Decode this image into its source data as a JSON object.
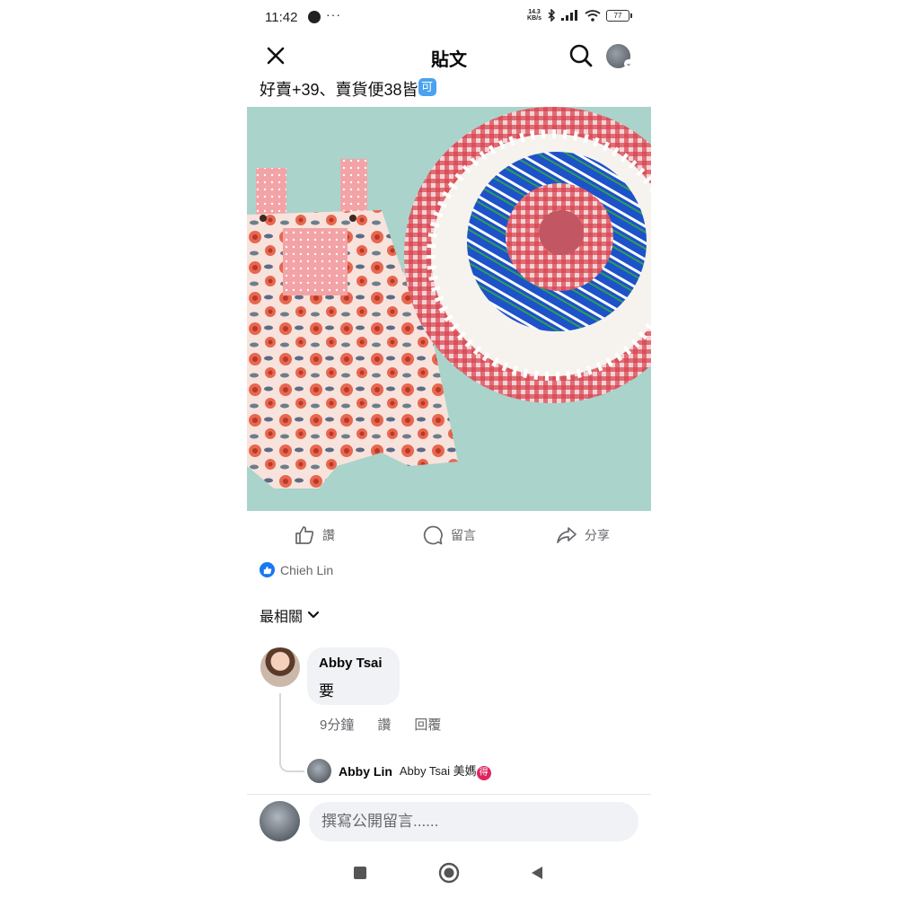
{
  "status_bar": {
    "time": "11:42",
    "more": "···",
    "speed_value": "14.3",
    "speed_unit": "KB/s",
    "battery": "77"
  },
  "header": {
    "title": "貼文"
  },
  "post": {
    "text": "好賣+39、賣貨便38皆",
    "badge": "可"
  },
  "actions": {
    "like": "讚",
    "comment": "留言",
    "share": "分享"
  },
  "reactions": {
    "liker": "Chieh Lin"
  },
  "comments_sort": "最相關",
  "comment": {
    "author": "Abby Tsai",
    "text": "要",
    "time": "9分鐘",
    "like": "讚",
    "reply": "回覆"
  },
  "reply_preview": {
    "author": "Abby Lin",
    "text": "Abby Tsai 美媽",
    "badge": "得"
  },
  "composer": {
    "placeholder": "撰寫公開留言......"
  },
  "colors": {
    "facebook_blue": "#1877f2",
    "secondary_text": "#65676b",
    "bubble_bg": "#f0f2f5"
  }
}
